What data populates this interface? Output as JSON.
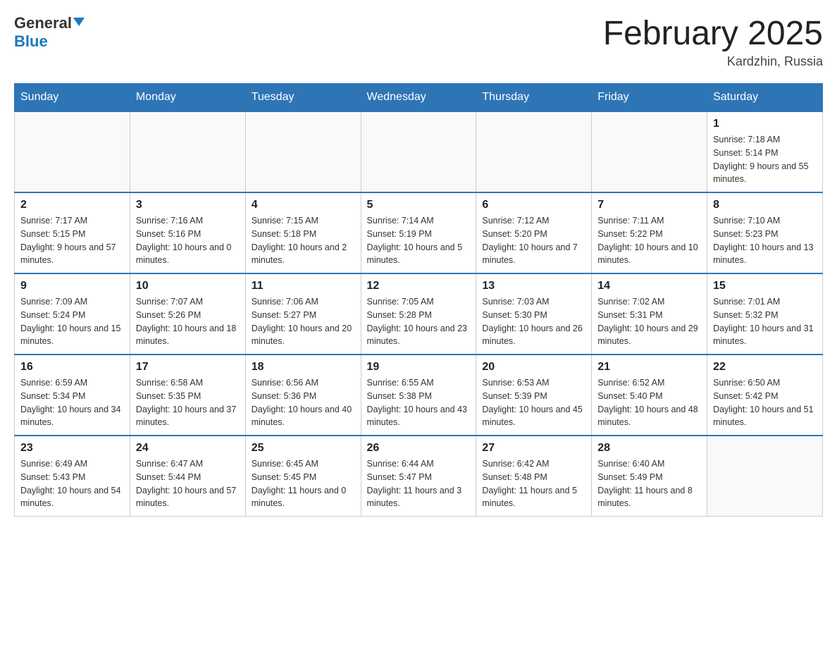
{
  "header": {
    "logo_general": "General",
    "logo_blue": "Blue",
    "month_title": "February 2025",
    "location": "Kardzhin, Russia"
  },
  "days_of_week": [
    "Sunday",
    "Monday",
    "Tuesday",
    "Wednesday",
    "Thursday",
    "Friday",
    "Saturday"
  ],
  "weeks": [
    [
      {
        "day": "",
        "info": ""
      },
      {
        "day": "",
        "info": ""
      },
      {
        "day": "",
        "info": ""
      },
      {
        "day": "",
        "info": ""
      },
      {
        "day": "",
        "info": ""
      },
      {
        "day": "",
        "info": ""
      },
      {
        "day": "1",
        "info": "Sunrise: 7:18 AM\nSunset: 5:14 PM\nDaylight: 9 hours and 55 minutes."
      }
    ],
    [
      {
        "day": "2",
        "info": "Sunrise: 7:17 AM\nSunset: 5:15 PM\nDaylight: 9 hours and 57 minutes."
      },
      {
        "day": "3",
        "info": "Sunrise: 7:16 AM\nSunset: 5:16 PM\nDaylight: 10 hours and 0 minutes."
      },
      {
        "day": "4",
        "info": "Sunrise: 7:15 AM\nSunset: 5:18 PM\nDaylight: 10 hours and 2 minutes."
      },
      {
        "day": "5",
        "info": "Sunrise: 7:14 AM\nSunset: 5:19 PM\nDaylight: 10 hours and 5 minutes."
      },
      {
        "day": "6",
        "info": "Sunrise: 7:12 AM\nSunset: 5:20 PM\nDaylight: 10 hours and 7 minutes."
      },
      {
        "day": "7",
        "info": "Sunrise: 7:11 AM\nSunset: 5:22 PM\nDaylight: 10 hours and 10 minutes."
      },
      {
        "day": "8",
        "info": "Sunrise: 7:10 AM\nSunset: 5:23 PM\nDaylight: 10 hours and 13 minutes."
      }
    ],
    [
      {
        "day": "9",
        "info": "Sunrise: 7:09 AM\nSunset: 5:24 PM\nDaylight: 10 hours and 15 minutes."
      },
      {
        "day": "10",
        "info": "Sunrise: 7:07 AM\nSunset: 5:26 PM\nDaylight: 10 hours and 18 minutes."
      },
      {
        "day": "11",
        "info": "Sunrise: 7:06 AM\nSunset: 5:27 PM\nDaylight: 10 hours and 20 minutes."
      },
      {
        "day": "12",
        "info": "Sunrise: 7:05 AM\nSunset: 5:28 PM\nDaylight: 10 hours and 23 minutes."
      },
      {
        "day": "13",
        "info": "Sunrise: 7:03 AM\nSunset: 5:30 PM\nDaylight: 10 hours and 26 minutes."
      },
      {
        "day": "14",
        "info": "Sunrise: 7:02 AM\nSunset: 5:31 PM\nDaylight: 10 hours and 29 minutes."
      },
      {
        "day": "15",
        "info": "Sunrise: 7:01 AM\nSunset: 5:32 PM\nDaylight: 10 hours and 31 minutes."
      }
    ],
    [
      {
        "day": "16",
        "info": "Sunrise: 6:59 AM\nSunset: 5:34 PM\nDaylight: 10 hours and 34 minutes."
      },
      {
        "day": "17",
        "info": "Sunrise: 6:58 AM\nSunset: 5:35 PM\nDaylight: 10 hours and 37 minutes."
      },
      {
        "day": "18",
        "info": "Sunrise: 6:56 AM\nSunset: 5:36 PM\nDaylight: 10 hours and 40 minutes."
      },
      {
        "day": "19",
        "info": "Sunrise: 6:55 AM\nSunset: 5:38 PM\nDaylight: 10 hours and 43 minutes."
      },
      {
        "day": "20",
        "info": "Sunrise: 6:53 AM\nSunset: 5:39 PM\nDaylight: 10 hours and 45 minutes."
      },
      {
        "day": "21",
        "info": "Sunrise: 6:52 AM\nSunset: 5:40 PM\nDaylight: 10 hours and 48 minutes."
      },
      {
        "day": "22",
        "info": "Sunrise: 6:50 AM\nSunset: 5:42 PM\nDaylight: 10 hours and 51 minutes."
      }
    ],
    [
      {
        "day": "23",
        "info": "Sunrise: 6:49 AM\nSunset: 5:43 PM\nDaylight: 10 hours and 54 minutes."
      },
      {
        "day": "24",
        "info": "Sunrise: 6:47 AM\nSunset: 5:44 PM\nDaylight: 10 hours and 57 minutes."
      },
      {
        "day": "25",
        "info": "Sunrise: 6:45 AM\nSunset: 5:45 PM\nDaylight: 11 hours and 0 minutes."
      },
      {
        "day": "26",
        "info": "Sunrise: 6:44 AM\nSunset: 5:47 PM\nDaylight: 11 hours and 3 minutes."
      },
      {
        "day": "27",
        "info": "Sunrise: 6:42 AM\nSunset: 5:48 PM\nDaylight: 11 hours and 5 minutes."
      },
      {
        "day": "28",
        "info": "Sunrise: 6:40 AM\nSunset: 5:49 PM\nDaylight: 11 hours and 8 minutes."
      },
      {
        "day": "",
        "info": ""
      }
    ]
  ]
}
